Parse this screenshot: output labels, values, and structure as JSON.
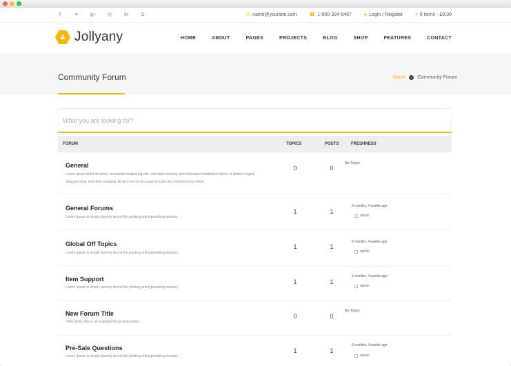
{
  "topbar": {
    "social": [
      {
        "icon": "facebook-icon",
        "glyph": "f"
      },
      {
        "icon": "twitter-icon",
        "glyph": "❧"
      },
      {
        "icon": "googleplus-icon",
        "glyph": "g+"
      },
      {
        "icon": "dribbble-icon",
        "glyph": "◎"
      },
      {
        "icon": "linkedin-icon",
        "glyph": "in"
      },
      {
        "icon": "skype-icon",
        "glyph": "S"
      }
    ],
    "email": "name@yoursite.com",
    "phone": "1-900-324-5467",
    "login": "Login / Register",
    "cart": "0 items - £0.00"
  },
  "header": {
    "logo_text": "Jollyany",
    "nav": [
      "HOME",
      "ABOUT",
      "PAGES",
      "PROJECTS",
      "BLOG",
      "SHOP",
      "FEATURES",
      "CONTACT"
    ]
  },
  "titlebar": {
    "title": "Community Forum",
    "breadcrumb_home": "Home",
    "breadcrumb_current": "Community Forum"
  },
  "search": {
    "placeholder": "What you are looking for?"
  },
  "table": {
    "headers": {
      "forum": "FORUM",
      "topics": "TOPICS",
      "posts": "POSTS",
      "freshness": "FRESHNESS"
    },
    "rows": [
      {
        "name": "General",
        "desc": "Lorem ipsum dolor sit amet, consetetur sadipscing elitr, sed diam nonumy eirmod tempor invidunt ut labore et dolore magna aliquyam erat, sed diam voluptua. At vero eos et accusam et justo duo dolores et ea rebum.",
        "topics": "0",
        "posts": "0",
        "freshness": "No Topics",
        "author": ""
      },
      {
        "name": "General Forums",
        "desc": "Lorem Ipsum is simply dummy text of the printing and typesetting industry.",
        "topics": "1",
        "posts": "1",
        "freshness": "6 months, 4 weeks ago",
        "author": "admin"
      },
      {
        "name": "Global Off Topics",
        "desc": "Lorem Ipsum is simply dummy text of the printing and typesetting industry.",
        "topics": "1",
        "posts": "1",
        "freshness": "6 months, 4 weeks ago",
        "author": "admin"
      },
      {
        "name": "Item Support",
        "desc": "Lorem Ipsum is simply dummy text of the printing and typesetting industry.",
        "topics": "1",
        "posts": "1",
        "freshness": "6 months, 4 weeks ago",
        "author": "admin"
      },
      {
        "name": "New Forum Title",
        "desc": "Hello there, this is an example forum description.",
        "topics": "0",
        "posts": "0",
        "freshness": "No Topics",
        "author": ""
      },
      {
        "name": "Pre-Sale Questions",
        "desc": "Lorem Ipsum is simply dummy text of the printing and typesetting industry.",
        "topics": "1",
        "posts": "1",
        "freshness": "6 months, 4 weeks ago",
        "author": "admin"
      }
    ]
  },
  "colors": {
    "accent": "#f5b800"
  }
}
